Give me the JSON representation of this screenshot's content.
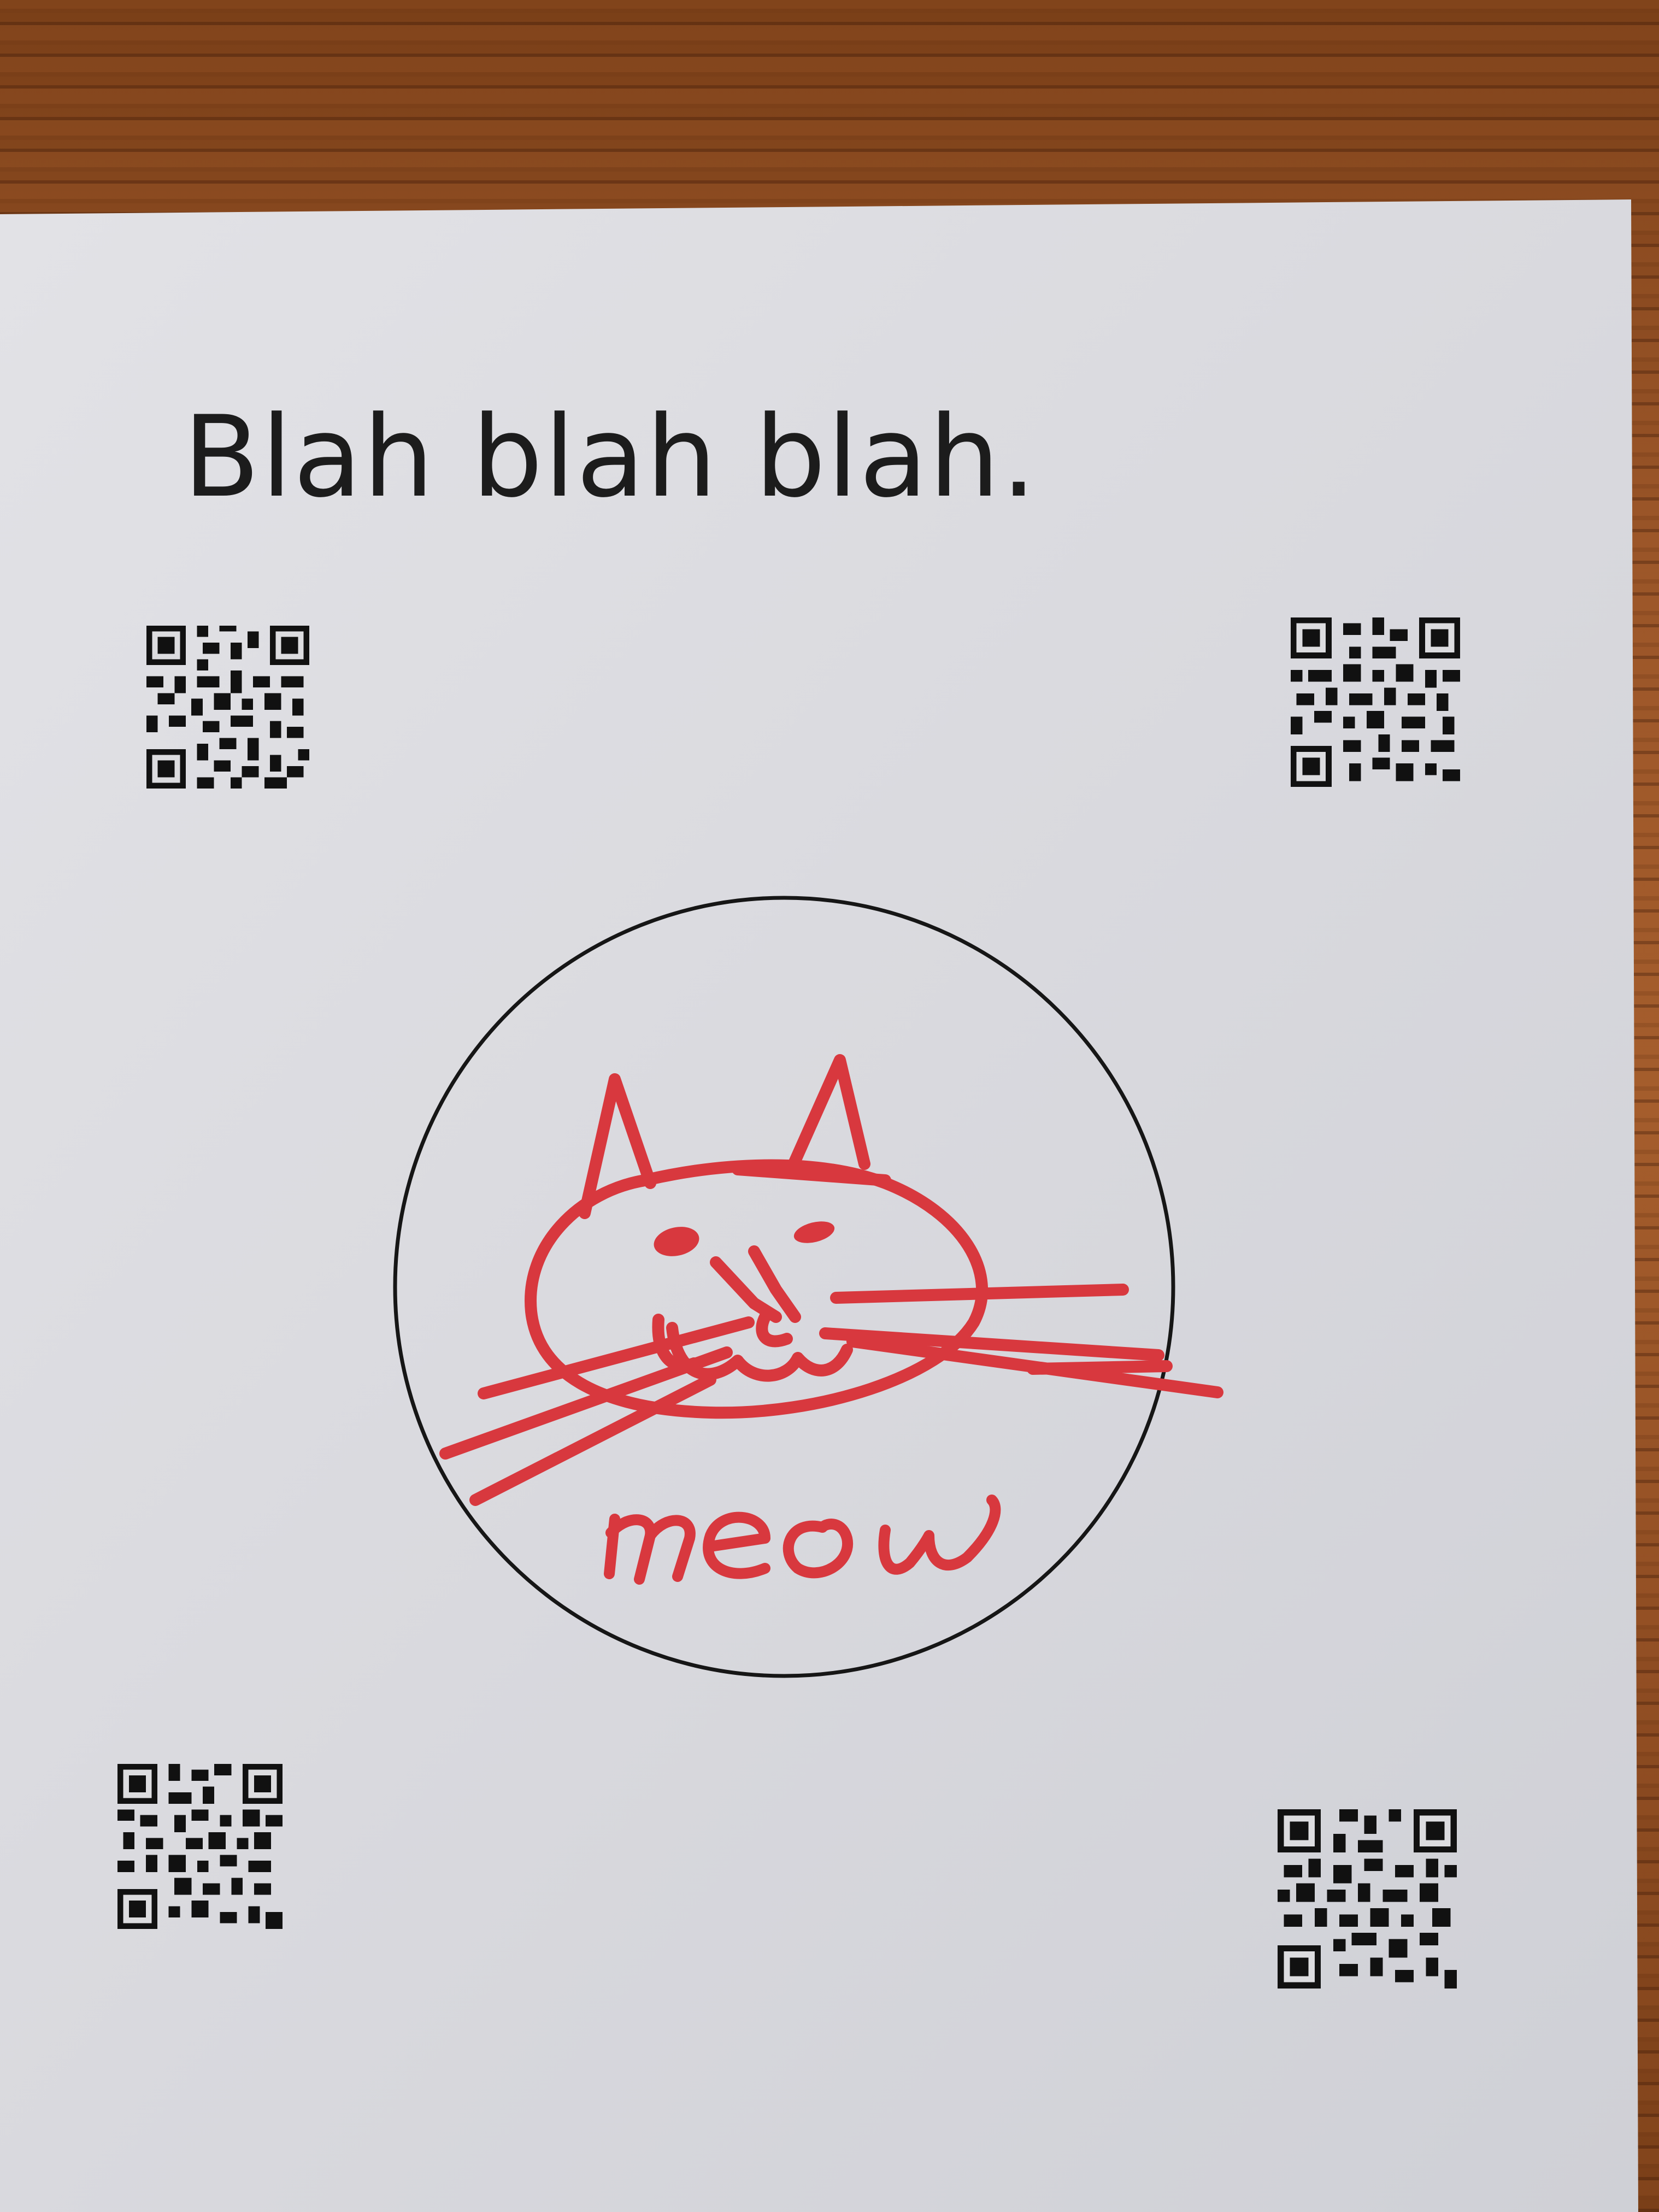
{
  "photo": {
    "subject": "paper-sheet-on-wooden-table",
    "heading_text": "Blah blah blah.",
    "handwritten_text": "meow",
    "qr_codes": [
      "qr-top-left",
      "qr-top-right",
      "qr-bottom-left",
      "qr-bottom-right"
    ],
    "icons": [
      "cat-drawing-icon",
      "target-circle-icon",
      "qr-code-icon"
    ],
    "colors": {
      "wood": "#9a5528",
      "paper": "#dcdcdf",
      "print_ink": "#1c1c1c",
      "marker_red": "#d8383e"
    }
  }
}
